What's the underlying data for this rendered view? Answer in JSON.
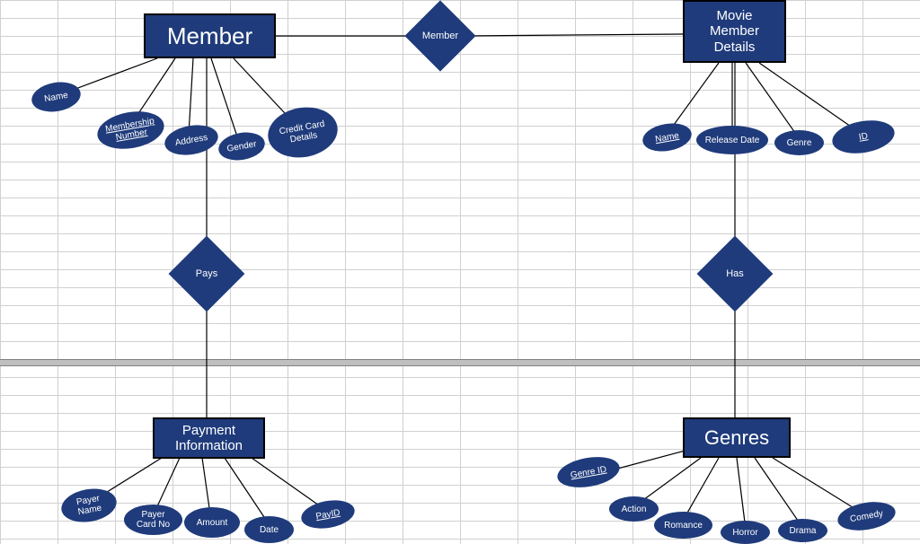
{
  "entities": {
    "member": "Member",
    "movie_member_details": "Movie\nMember\nDetails",
    "payment_information": "Payment\nInformation",
    "genres": "Genres"
  },
  "relationships": {
    "member_rel": "Member",
    "pays": "Pays",
    "has": "Has"
  },
  "attributes": {
    "member": {
      "name": "Name",
      "membership_number": "Membership\nNumber",
      "address": "Address",
      "gender": "Gender",
      "credit_card_details": "Credit Card\nDetails"
    },
    "movie": {
      "name": "Name",
      "release_date": "Release Date",
      "genre": "Genre",
      "id": "ID"
    },
    "payment": {
      "payer_name": "Payer\nName",
      "payer_card_no": "Payer\nCard No",
      "amount": "Amount",
      "date": "Date",
      "pay_id": "PayID"
    },
    "genres": {
      "genre_id": "Genre ID",
      "action": "Action",
      "romance": "Romance",
      "horror": "Horror",
      "drama": "Drama",
      "comedy": "Comedy"
    }
  },
  "colors": {
    "shape_fill": "#1f3b7b",
    "line": "#000000",
    "grid": "#d0d0d0"
  }
}
